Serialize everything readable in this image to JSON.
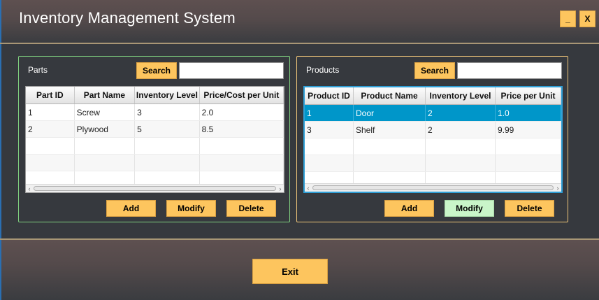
{
  "app": {
    "title": "Inventory Management System",
    "minimize_label": "_",
    "close_label": "X"
  },
  "parts": {
    "label": "Parts",
    "search_label": "Search",
    "search_value": "",
    "columns": [
      "Part ID",
      "Part Name",
      "Inventory Level",
      "Price/Cost per Unit"
    ],
    "rows": [
      [
        "1",
        "Screw",
        "3",
        "2.0"
      ],
      [
        "2",
        "Plywood",
        "5",
        "8.5"
      ]
    ],
    "add_label": "Add",
    "modify_label": "Modify",
    "delete_label": "Delete"
  },
  "products": {
    "label": "Products",
    "search_label": "Search",
    "search_value": "",
    "columns": [
      "Product ID",
      "Product Name",
      "Inventory Level",
      "Price per Unit"
    ],
    "rows": [
      [
        "1",
        "Door",
        "2",
        "1.0"
      ],
      [
        "3",
        "Shelf",
        "2",
        "9.99"
      ]
    ],
    "selected_row": 0,
    "add_label": "Add",
    "modify_label": "Modify",
    "delete_label": "Delete"
  },
  "footer": {
    "exit_label": "Exit"
  },
  "colors": {
    "accent_button": "#fdc55e",
    "highlight_button": "#c9f5c9",
    "selection": "#0096c9",
    "parts_border": "#7fd17f",
    "products_border": "#f0c679"
  }
}
